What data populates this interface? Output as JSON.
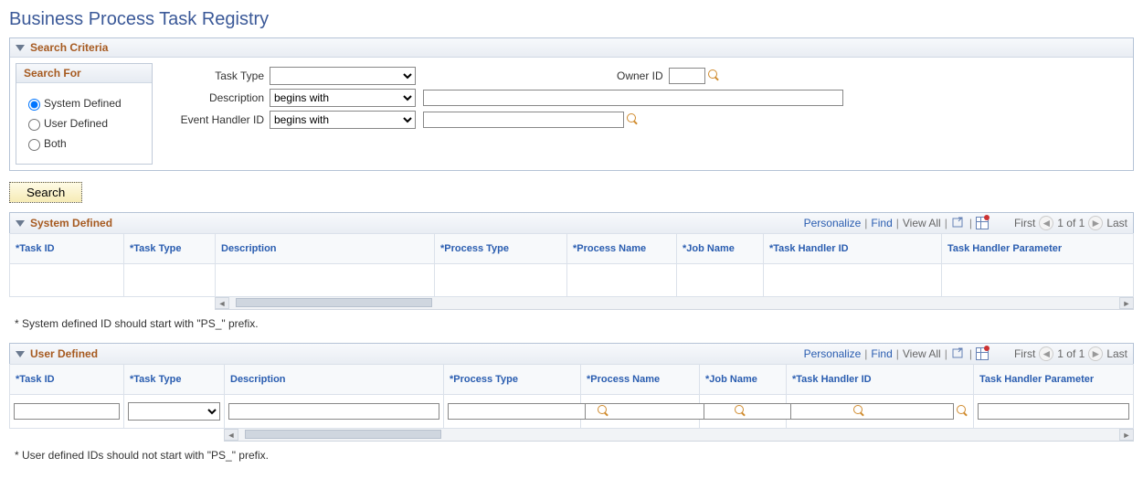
{
  "page_title": "Business Process Task Registry",
  "search_criteria": {
    "title": "Search Criteria",
    "search_for": {
      "title": "Search For",
      "options": {
        "system_defined": "System Defined",
        "user_defined": "User Defined",
        "both": "Both"
      },
      "selected": "system_defined"
    },
    "fields": {
      "task_type_label": "Task Type",
      "task_type_value": "",
      "owner_id_label": "Owner ID",
      "owner_id_value": "",
      "description_label": "Description",
      "description_op": "begins with",
      "description_value": "",
      "event_handler_label": "Event Handler ID",
      "event_handler_op": "begins with",
      "event_handler_value": ""
    }
  },
  "search_button": "Search",
  "grid_common": {
    "personalize": "Personalize",
    "find": "Find",
    "view_all": "View All",
    "first": "First",
    "last": "Last",
    "pagination": "1 of 1"
  },
  "system_defined_grid": {
    "title": "System Defined",
    "columns": {
      "task_id": "*Task ID",
      "task_type": "*Task Type",
      "description": "Description",
      "process_type": "*Process Type",
      "process_name": "*Process Name",
      "job_name": "*Job Name",
      "task_handler_id": "*Task Handler ID",
      "task_handler_param": "Task Handler Parameter"
    },
    "row": {
      "task_id": "",
      "task_type": "",
      "description": "",
      "process_type": "",
      "process_name": "",
      "job_name": "",
      "task_handler_id": "",
      "task_handler_param": ""
    },
    "footnote": "* System defined ID should start with \"PS_\" prefix."
  },
  "user_defined_grid": {
    "title": "User Defined",
    "columns": {
      "task_id": "*Task ID",
      "task_type": "*Task Type",
      "description": "Description",
      "process_type": "*Process Type",
      "process_name": "*Process Name",
      "job_name": "*Job Name",
      "task_handler_id": "*Task Handler ID",
      "task_handler_param": "Task Handler Parameter"
    },
    "row": {
      "task_id": "",
      "task_type_value": "",
      "description": "",
      "process_type": "",
      "process_name": "",
      "job_name": "",
      "task_handler_id": "",
      "task_handler_param": ""
    },
    "footnote": "* User defined IDs should not start with \"PS_\" prefix."
  }
}
